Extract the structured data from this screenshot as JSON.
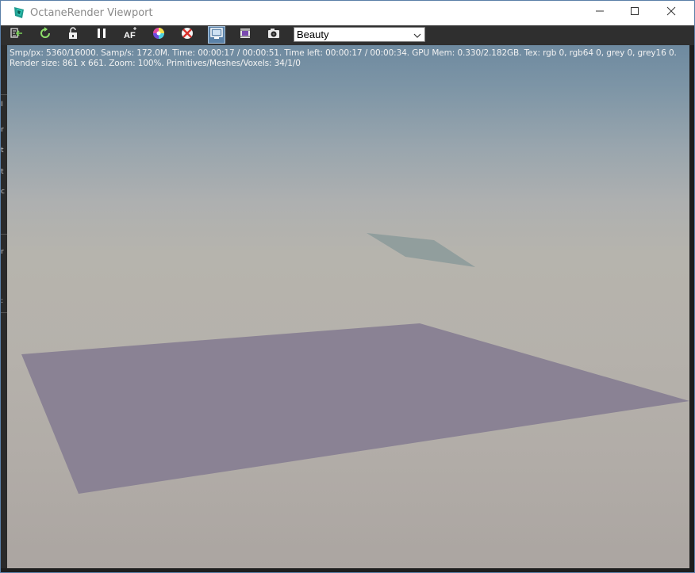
{
  "window": {
    "title": "OctaneRender Viewport",
    "minimize_icon": "minimize-icon",
    "maximize_icon": "maximize-icon",
    "close_icon": "close-icon"
  },
  "toolbar": {
    "buttons": [
      {
        "name": "send-scene-button",
        "icon": "send-icon"
      },
      {
        "name": "restart-render-button",
        "icon": "refresh-icon"
      },
      {
        "name": "lock-button",
        "icon": "lock-icon"
      },
      {
        "name": "pause-render-button",
        "icon": "pause-icon"
      },
      {
        "name": "auto-focus-button",
        "icon": "af-icon",
        "label": "AF"
      },
      {
        "name": "color-picker-button",
        "icon": "color-wheel-icon"
      },
      {
        "name": "region-render-button",
        "icon": "region-icon"
      },
      {
        "name": "viewport-display-button",
        "icon": "monitor-icon",
        "active": true
      },
      {
        "name": "film-settings-button",
        "icon": "film-icon"
      },
      {
        "name": "camera-button",
        "icon": "camera-icon"
      }
    ],
    "render_pass": {
      "selected": "Beauty"
    }
  },
  "stats": {
    "line1": "Smp/px: 5360/16000.   Samp/s: 172.0M.   Time: 00:00:17 / 00:00:51.   Time left: 00:00:17 / 00:00:34.   GPU Mem: 0.330/2.182GB.   Tex: rgb 0, rgb64 0, grey 0, grey16 0.",
    "line2": "Render size: 861 x 661.   Zoom: 100%.   Primitives/Meshes/Voxels: 34/1/0"
  },
  "colors": {
    "ground_plane": "#8a8294",
    "floating_plane": "#8d9b9b",
    "active_button": "#5b82a8"
  }
}
